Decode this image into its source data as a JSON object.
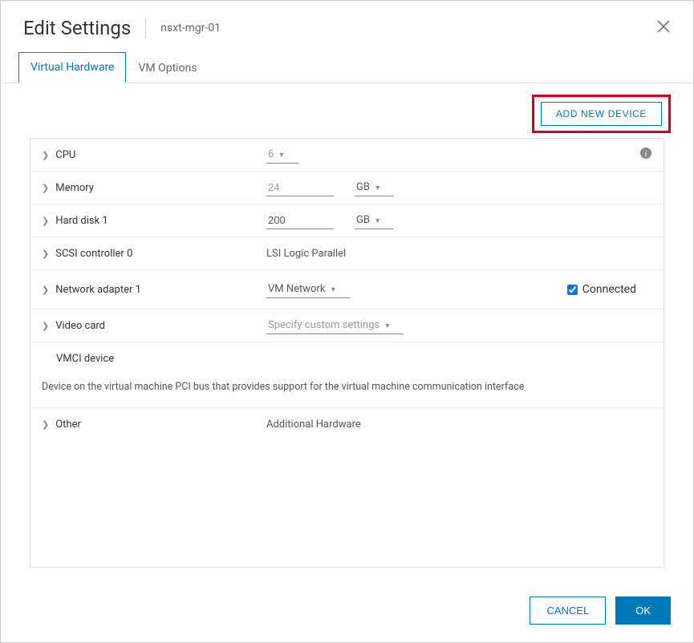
{
  "header": {
    "title": "Edit Settings",
    "vm_name": "nsxt-mgr-01"
  },
  "tabs": {
    "virtual_hardware": "Virtual Hardware",
    "vm_options": "VM Options"
  },
  "toolbar": {
    "add_device": "ADD NEW DEVICE"
  },
  "hw": {
    "cpu": {
      "label": "CPU",
      "value": "6"
    },
    "memory": {
      "label": "Memory",
      "value": "24",
      "unit": "GB"
    },
    "disk": {
      "label": "Hard disk 1",
      "value": "200",
      "unit": "GB"
    },
    "scsi": {
      "label": "SCSI controller 0",
      "value": "LSI Logic Parallel"
    },
    "net": {
      "label": "Network adapter 1",
      "value": "VM Network",
      "connected_label": "Connected"
    },
    "video": {
      "label": "Video card",
      "value": "Specify custom settings"
    },
    "vmci": {
      "label": "VMCI device",
      "desc": "Device on the virtual machine PCI bus that provides support for the virtual machine communication interface"
    },
    "other": {
      "label": "Other",
      "value": "Additional Hardware"
    }
  },
  "footer": {
    "cancel": "CANCEL",
    "ok": "OK"
  }
}
